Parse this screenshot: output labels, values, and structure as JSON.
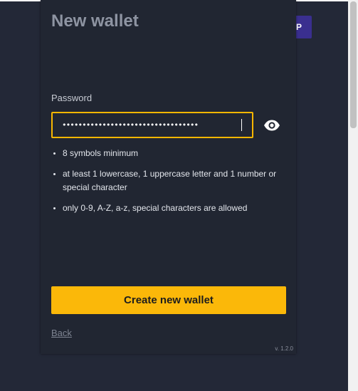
{
  "background": {
    "button_label": "P"
  },
  "wallet": {
    "title": "New wallet",
    "password_label": "Password",
    "password_value": "••••••••••••••••••••••••••••••••••",
    "toggle_icon": "eye-icon",
    "rules": [
      "8 symbols minimum",
      "at least 1 lowercase, 1 uppercase letter and 1 number or special character",
      "only 0-9, A-Z, a-z, special characters are allowed"
    ],
    "create_label": "Create new wallet",
    "back_label": "Back",
    "version": "v. 1.2.0"
  },
  "colors": {
    "background": "#232837",
    "panel": "#212632",
    "accent": "#fbb809",
    "input_border": "#f8b600",
    "background_button": "#3a2f8f"
  }
}
